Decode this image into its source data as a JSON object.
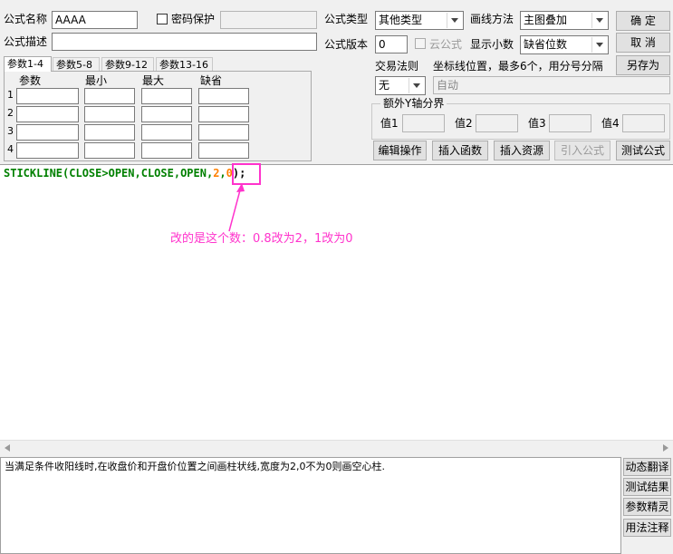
{
  "form": {
    "name_label": "公式名称",
    "name_value": "AAAA",
    "password_label": "密码保护",
    "desc_label": "公式描述",
    "desc_value": "",
    "type_label": "公式类型",
    "type_value": "其他类型",
    "draw_label": "画线方法",
    "draw_value": "主图叠加",
    "version_label": "公式版本",
    "version_value": "0",
    "cloud_label": "云公式",
    "decimal_label": "显示小数",
    "decimal_value": "缺省位数",
    "trade_label": "交易法则",
    "trade_value": "无",
    "axis_hint": "坐标线位置，最多6个，用分号分隔",
    "axis_value": "自动"
  },
  "buttons": {
    "ok": "确 定",
    "cancel": "取 消",
    "save_as": "另存为",
    "edit": "编辑操作",
    "insert_func": "插入函数",
    "insert_res": "插入资源",
    "import": "引入公式",
    "test": "测试公式"
  },
  "params": {
    "tabs": [
      "参数1-4",
      "参数5-8",
      "参数9-12",
      "参数13-16"
    ],
    "headers": [
      "参数",
      "最小",
      "最大",
      "缺省"
    ],
    "rows": [
      "1",
      "2",
      "3",
      "4"
    ]
  },
  "yaxis": {
    "title": "额外Y轴分界",
    "labels": [
      "值1",
      "值2",
      "值3",
      "值4"
    ]
  },
  "code": {
    "prefix": "STICKLINE(CLOSE>OPEN,CLOSE,OPEN,",
    "num1": "2",
    "comma": ",",
    "num2": "0",
    "suffix": ");"
  },
  "annotation": {
    "text": "改的是这个数：0.8改为2，1改为0",
    "color": "#ff33cc"
  },
  "description": "当满足条件收阳线时,在收盘价和开盘价位置之间画柱状线,宽度为2,0不为0则画空心柱.",
  "side_buttons": [
    "动态翻译",
    "测试结果",
    "参数精灵",
    "用法注释"
  ],
  "colors": {
    "code_green": "#008000",
    "code_blue": "#0000ff",
    "code_orange": "#ff8000",
    "highlight": "#ff33cc"
  }
}
